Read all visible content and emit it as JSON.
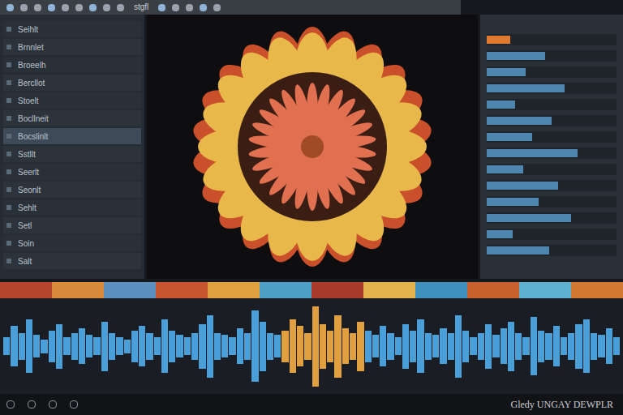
{
  "window": {
    "title": "stgfl"
  },
  "toolbar": {
    "icon_count": "14"
  },
  "left_panel": {
    "rows": [
      {
        "label": "Seihlt",
        "selected": false
      },
      {
        "label": "Brnnlet",
        "selected": false
      },
      {
        "label": "Broeelh",
        "selected": false
      },
      {
        "label": "Bercllot",
        "selected": false
      },
      {
        "label": "Stoelt",
        "selected": false
      },
      {
        "label": "Bocllneit",
        "selected": false
      },
      {
        "label": "Bocslinlt",
        "selected": true
      },
      {
        "label": "Sstllt",
        "selected": false
      },
      {
        "label": "Seerlt",
        "selected": false
      },
      {
        "label": "Seonlt",
        "selected": false
      },
      {
        "label": "Sehlt",
        "selected": false
      },
      {
        "label": "Setl",
        "selected": false
      },
      {
        "label": "Soin",
        "selected": false
      },
      {
        "label": "Salt",
        "selected": false
      }
    ]
  },
  "right_panel": {
    "rows": [
      {
        "level": 0.18,
        "selected": true
      },
      {
        "level": 0.45,
        "selected": false
      },
      {
        "level": 0.3,
        "selected": false
      },
      {
        "level": 0.6,
        "selected": false
      },
      {
        "level": 0.22,
        "selected": false
      },
      {
        "level": 0.5,
        "selected": false
      },
      {
        "level": 0.35,
        "selected": false
      },
      {
        "level": 0.7,
        "selected": false
      },
      {
        "level": 0.28,
        "selected": false
      },
      {
        "level": 0.55,
        "selected": false
      },
      {
        "level": 0.4,
        "selected": false
      },
      {
        "level": 0.65,
        "selected": false
      },
      {
        "level": 0.2,
        "selected": false
      },
      {
        "level": 0.48,
        "selected": false
      }
    ]
  },
  "clip_strip": [
    {
      "color": "#b5452b"
    },
    {
      "color": "#d98a3a"
    },
    {
      "color": "#5a8fc0"
    },
    {
      "color": "#c7552f"
    },
    {
      "color": "#e0a040"
    },
    {
      "color": "#4f9fc9"
    },
    {
      "color": "#a83a2a"
    },
    {
      "color": "#e3b24a"
    },
    {
      "color": "#3f8fbf"
    },
    {
      "color": "#c9612f"
    },
    {
      "color": "#5fb0d0"
    },
    {
      "color": "#d27a34"
    }
  ],
  "waveform": {
    "values": [
      0.2,
      0.45,
      0.3,
      0.6,
      0.25,
      0.15,
      0.35,
      0.5,
      0.2,
      0.3,
      0.4,
      0.25,
      0.2,
      0.55,
      0.3,
      0.2,
      0.15,
      0.35,
      0.45,
      0.3,
      0.2,
      0.6,
      0.35,
      0.25,
      0.2,
      0.3,
      0.5,
      0.7,
      0.3,
      0.25,
      0.2,
      0.4,
      0.3,
      0.8,
      0.55,
      0.3,
      0.25,
      0.35,
      0.6,
      0.45,
      0.3,
      0.9,
      0.5,
      0.35,
      0.7,
      0.4,
      0.3,
      0.55,
      0.35,
      0.25,
      0.45,
      0.3,
      0.2,
      0.5,
      0.35,
      0.6,
      0.3,
      0.25,
      0.4,
      0.3,
      0.7,
      0.35,
      0.2,
      0.3,
      0.5,
      0.25,
      0.4,
      0.55,
      0.3,
      0.2,
      0.65,
      0.35,
      0.3,
      0.45,
      0.2,
      0.3,
      0.5,
      0.6,
      0.3,
      0.25,
      0.4,
      0.2
    ]
  },
  "watermark": "Gledy UNGAY DEWPLR",
  "bottom_bar": {
    "icon_count": "4"
  }
}
